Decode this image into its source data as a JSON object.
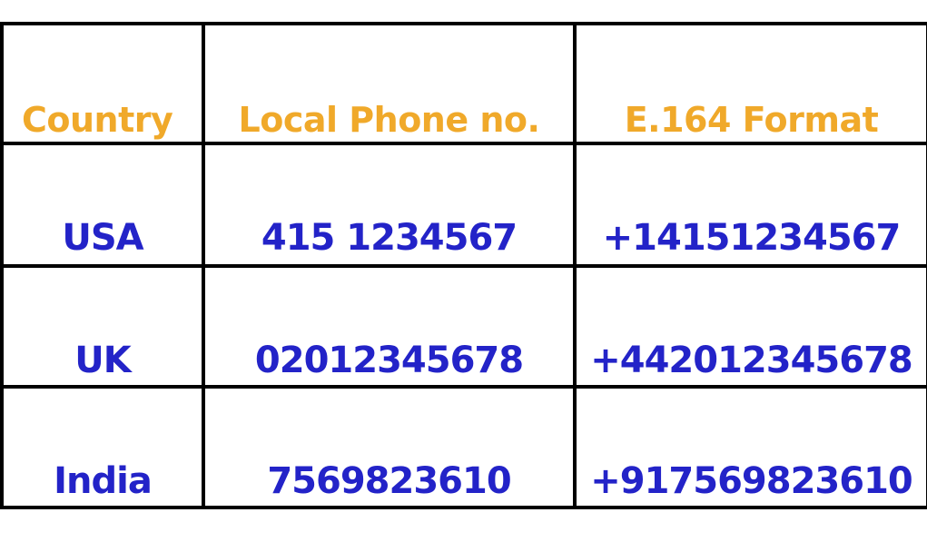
{
  "colors": {
    "header_text": "#f0a92a",
    "cell_text": "#2323c8",
    "border": "#000000"
  },
  "table": {
    "headers": [
      "Country",
      "Local Phone no.",
      "E.164 Format"
    ],
    "rows": [
      [
        "USA",
        "415 1234567",
        "+14151234567"
      ],
      [
        "UK",
        "02012345678",
        "+442012345678"
      ],
      [
        "India",
        "7569823610",
        "+917569823610"
      ]
    ]
  }
}
